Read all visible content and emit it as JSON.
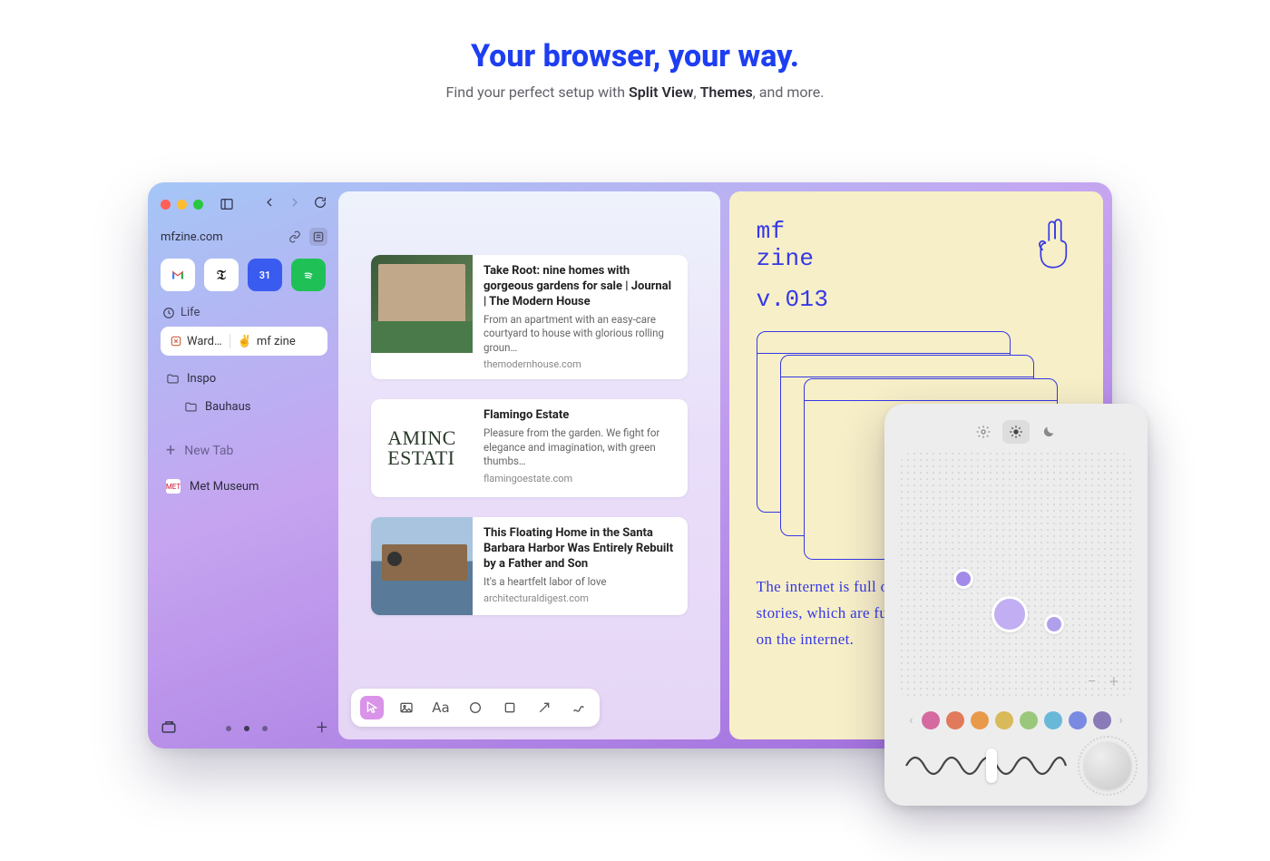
{
  "hero": {
    "title": "Your browser, your way.",
    "sub_prefix": "Find your perfect setup with ",
    "sub_b1": "Split View",
    "sub_mid": ", ",
    "sub_b2": "Themes",
    "sub_suffix": ", and more."
  },
  "sidebar": {
    "url": "mfzine.com",
    "space": "Life",
    "split_tab": {
      "left": "Ward…",
      "right": "mf zine"
    },
    "folders": {
      "inspo": "Inspo",
      "bauhaus": "Bauhaus"
    },
    "new_tab": "New Tab",
    "tabs": {
      "met": "Met Museum"
    },
    "pinned": {
      "gmail": "M",
      "nyt": "𝔗",
      "cal": "31",
      "spotify": "●"
    }
  },
  "easel": {
    "cards": [
      {
        "title": "Take Root: nine homes with gorgeous gardens for sale | Journal | The Modern House",
        "desc": "From an apartment with an easy-care courtyard to house with glorious rolling groun…",
        "domain": "themodernhouse.com"
      },
      {
        "title": "Flamingo Estate",
        "desc": "Pleasure from the garden. We fight for elegance and imagination, with green thumbs…",
        "domain": "flamingoestate.com"
      },
      {
        "title": "This Floating Home in the Santa Barbara Harbor Was Entirely Rebuilt by a Father and Son",
        "desc": "It's a heartfelt labor of love",
        "domain": "architecturaldigest.com"
      }
    ],
    "flamingo_thumb": "AMINC\nESTATI"
  },
  "mfzine": {
    "title_l1": "mf",
    "title_l2": "zine",
    "version": "v.013",
    "body": "The internet is full of stories. So, too, are our stories, which are full of the paths we've taken on the internet."
  },
  "theme": {
    "swatches": [
      "#d46aa0",
      "#e07a5a",
      "#e89a4a",
      "#d8ba5a",
      "#9ac87a",
      "#6ab8d8",
      "#7a8ae2",
      "#8a7ab8"
    ],
    "minus": "−",
    "plus": "+"
  }
}
